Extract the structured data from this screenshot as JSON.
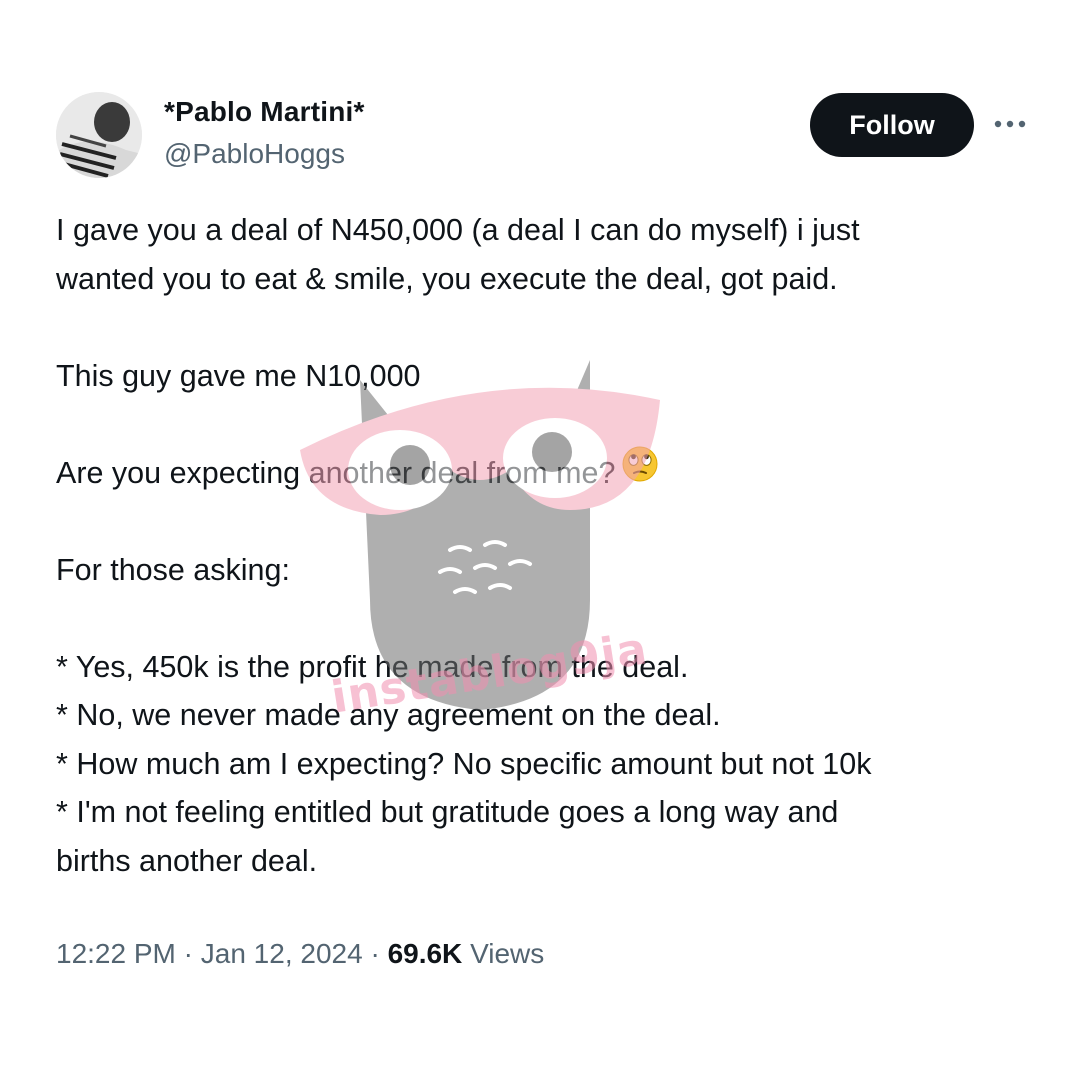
{
  "tweet": {
    "author_name": "*Pablo Martini*",
    "author_handle": "@PabloHoggs",
    "follow_label": "Follow",
    "lines": [
      "I gave you a deal of N450,000 (a deal I can do myself) i just",
      "wanted you to eat & smile, you execute the deal, got paid.",
      "",
      "This guy gave me N10,000",
      "",
      "Are you expecting another deal from me?",
      "",
      "For those asking:",
      "",
      "* Yes, 450k is the profit he made from the deal.",
      "* No, we never made any agreement on the deal.",
      "* How much am I expecting? No specific amount but not 10k",
      "* I'm not feeling entitled but gratitude goes a long way and",
      "births another deal."
    ],
    "emoji": "face-with-rolling-eyes-icon",
    "time": "12:22 PM",
    "separator": "·",
    "date": "Jan 12, 2024",
    "views_count": "69.6K",
    "views_label": "Views"
  },
  "watermark": {
    "text": "instablog9ja",
    "color": "#f28fb0"
  },
  "colors": {
    "text": "#0f1419",
    "secondary": "#536471",
    "button_bg": "#0f1419",
    "button_text": "#ffffff"
  }
}
